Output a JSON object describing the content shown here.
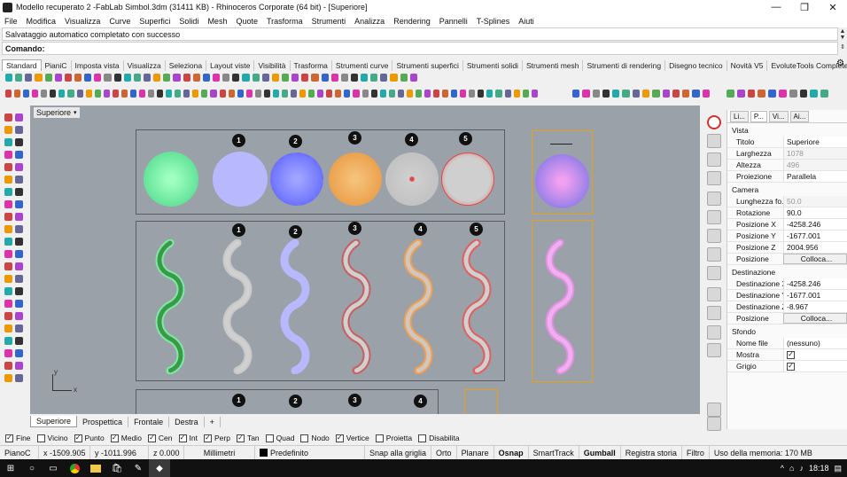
{
  "window": {
    "title": "Modello recuperato 2 -FabLab Simbol.3dm (31411 KB) - Rhinoceros Corporate (64 bit) - [Superiore]",
    "minimize": "—",
    "maximize": "❐",
    "close": "✕"
  },
  "menu": [
    "File",
    "Modifica",
    "Visualizza",
    "Curve",
    "Superfici",
    "Solidi",
    "Mesh",
    "Quote",
    "Trasforma",
    "Strumenti",
    "Analizza",
    "Rendering",
    "Pannelli",
    "T-Splines",
    "Aiuti"
  ],
  "command": {
    "history": "Salvataggio automatico completato con successo",
    "prompt": "Comando:"
  },
  "toolbar_tabs": [
    "Standard",
    "PianiC",
    "Imposta vista",
    "Visualizza",
    "Seleziona",
    "Layout viste",
    "Visibilità",
    "Trasforma",
    "Strumenti curve",
    "Strumenti superfici",
    "Strumenti solidi",
    "Strumenti mesh",
    "Strumenti di rendering",
    "Disegno tecnico",
    "Novità V5",
    "EvoluteTools Complete"
  ],
  "viewport": {
    "name": "Superiore",
    "caret": "▾",
    "axis_x": "x",
    "axis_y": "y",
    "row1_numbers": [
      "1",
      "2",
      "3",
      "4",
      "5"
    ],
    "row2_numbers": [
      "1",
      "2",
      "3",
      "4",
      "5"
    ],
    "row3_numbers": [
      "1",
      "2",
      "3",
      "4"
    ],
    "colors": {
      "background": "#9aa1a8",
      "green": "#7ee8a8",
      "lavender": "#b8b8ff",
      "blue": "#7a80ff",
      "orange": "#f0a050",
      "gray": "#c8c8c8",
      "red": "#e04848",
      "pink": "#e090e0",
      "frame": "#e3a21a"
    }
  },
  "view_tabs": [
    "Superiore",
    "Prospettica",
    "Frontale",
    "Destra",
    "+"
  ],
  "props": {
    "tabs": [
      "Li...",
      "P...",
      "Vi...",
      "Ai..."
    ],
    "vista_title": "Vista",
    "vista": [
      {
        "k": "Titolo",
        "v": "Superiore"
      },
      {
        "k": "Larghezza",
        "v": "1078"
      },
      {
        "k": "Altezza",
        "v": "496"
      },
      {
        "k": "Proiezione",
        "v": "Parallela"
      }
    ],
    "camera_title": "Camera",
    "camera": [
      {
        "k": "Lunghezza fo...",
        "v": "50.0"
      },
      {
        "k": "Rotazione",
        "v": "90.0"
      },
      {
        "k": "Posizione X",
        "v": "-4258.246"
      },
      {
        "k": "Posizione Y",
        "v": "-1677.001"
      },
      {
        "k": "Posizione Z",
        "v": "2004.956"
      },
      {
        "k": "Posizione",
        "v": "Colloca..."
      }
    ],
    "dest_title": "Destinazione",
    "dest": [
      {
        "k": "Destinazione X",
        "v": "-4258.246"
      },
      {
        "k": "Destinazione Y",
        "v": "-1677.001"
      },
      {
        "k": "Destinazione Z",
        "v": "-8.967"
      },
      {
        "k": "Posizione",
        "v": "Colloca..."
      }
    ],
    "sfondo_title": "Sfondo",
    "sfondo": [
      {
        "k": "Nome file",
        "v": "(nessuno)"
      },
      {
        "k": "Mostra",
        "v": "✓"
      },
      {
        "k": "Grigio",
        "v": "✓"
      }
    ],
    "browse": "..."
  },
  "osnap": [
    {
      "label": "Fine",
      "checked": "✓"
    },
    {
      "label": "Vicino",
      "checked": ""
    },
    {
      "label": "Punto",
      "checked": "✓"
    },
    {
      "label": "Medio",
      "checked": "✓"
    },
    {
      "label": "Cen",
      "checked": "✓"
    },
    {
      "label": "Int",
      "checked": "✓"
    },
    {
      "label": "Perp",
      "checked": "✓"
    },
    {
      "label": "Tan",
      "checked": "✓"
    },
    {
      "label": "Quad",
      "checked": ""
    },
    {
      "label": "Nodo",
      "checked": ""
    },
    {
      "label": "Vertice",
      "checked": "✓"
    },
    {
      "label": "Proietta",
      "checked": ""
    },
    {
      "label": "Disabilita",
      "checked": ""
    }
  ],
  "status": {
    "plane": "PianoC",
    "x": "x -1509.905",
    "y": "y -1011.996",
    "z": "z 0.000",
    "units": "Millimetri",
    "layer": "Predefinito",
    "buttons": [
      "Snap alla griglia",
      "Orto",
      "Planare",
      "Osnap",
      "SmartTrack",
      "Gumball",
      "Registra storia",
      "Filtro"
    ],
    "memory": "Uso della memoria: 170 MB"
  },
  "taskbar": {
    "time": "18:18"
  }
}
